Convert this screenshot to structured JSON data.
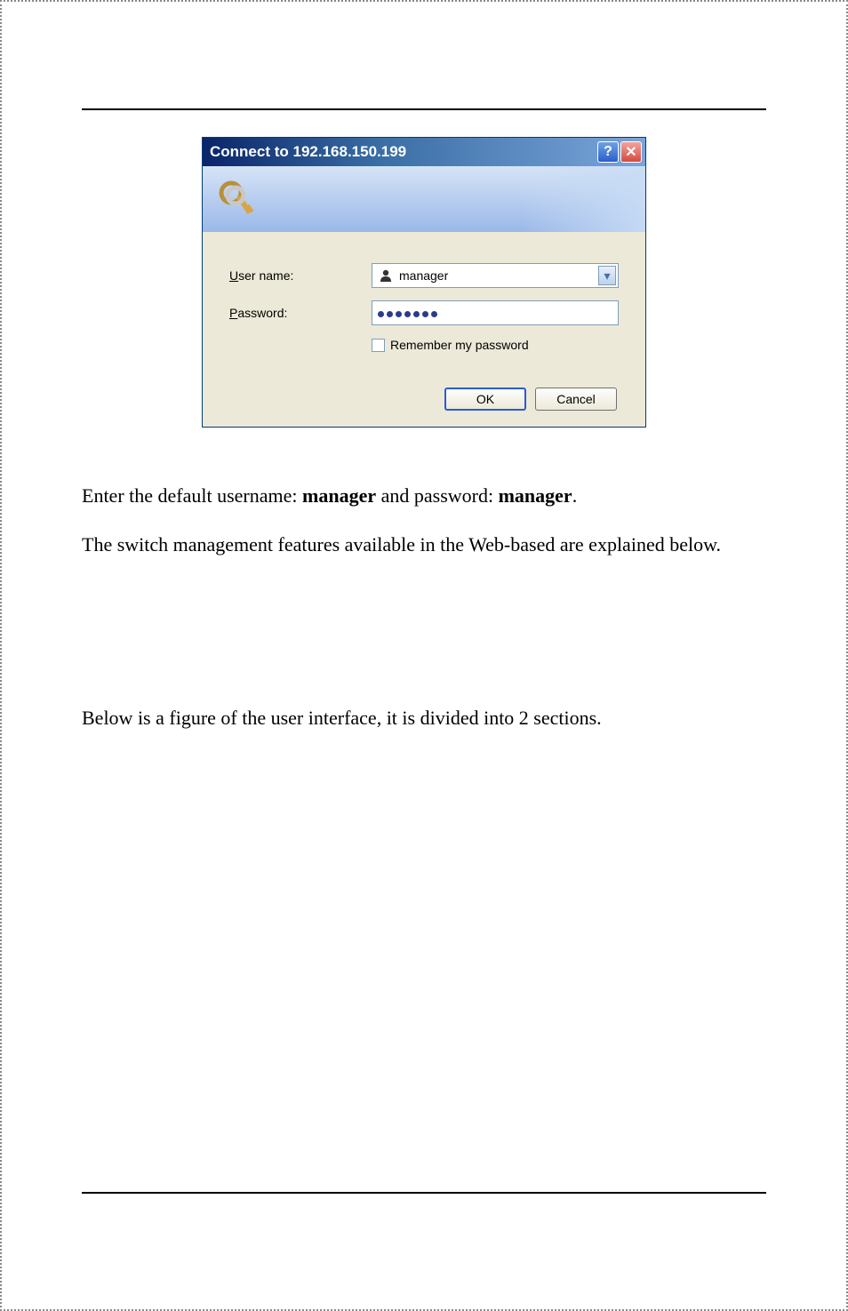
{
  "dialog": {
    "title": "Connect to 192.168.150.199",
    "labels": {
      "username": "User name:",
      "password": "Password:",
      "remember": "Remember my password"
    },
    "fields": {
      "username_value": "manager",
      "password_masked_dots": 7
    },
    "buttons": {
      "ok": "OK",
      "cancel": "Cancel"
    }
  },
  "doc": {
    "p1_prefix": "Enter the default username: ",
    "p1_bold1": "manager",
    "p1_mid": " and password: ",
    "p1_bold2": "manager",
    "p1_suffix": ".",
    "p2": "The switch management features available in the Web-based are explained below.",
    "p3": "Below is a figure of the user interface, it is divided into 2 sections."
  }
}
